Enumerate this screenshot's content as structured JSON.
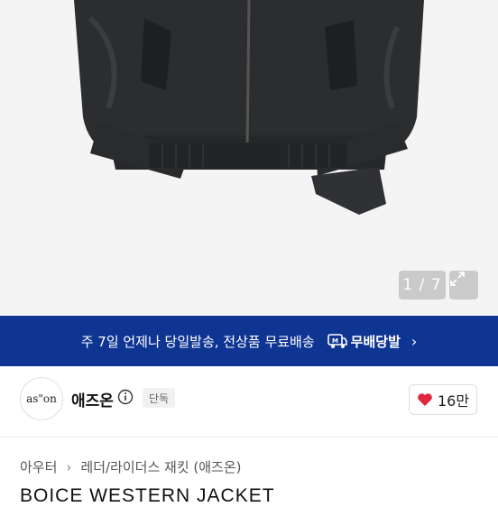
{
  "gallery": {
    "counter": "1 / 7"
  },
  "banner": {
    "text": "주 7일 언제나 당일발송, 전상품 무료배송",
    "badge": "무배당발",
    "chevron": "›"
  },
  "shop": {
    "avatar_text": "as\"on",
    "name": "애즈온",
    "tag": "단독",
    "likes": "16만"
  },
  "breadcrumb": {
    "items": [
      "아우터",
      "레더/라이더스 재킷 (애즈온)"
    ],
    "separator": "›"
  },
  "product": {
    "title": "BOICE WESTERN JACKET"
  },
  "colors": {
    "banner_bg": "#0f3593",
    "heart": "#e0263c"
  },
  "icons": {
    "expand": "expand-icon",
    "info": "info-icon",
    "heart": "heart-icon",
    "delivery": "delivery-badge-icon"
  }
}
